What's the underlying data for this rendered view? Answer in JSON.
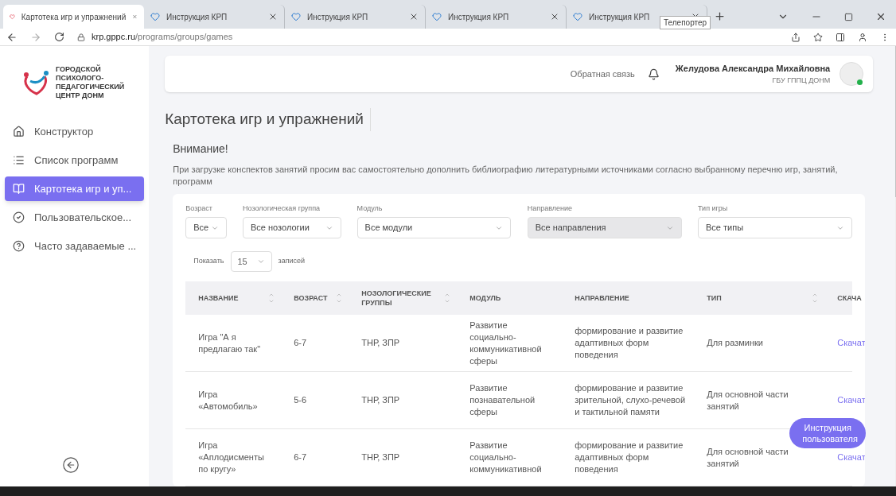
{
  "browser": {
    "tabs": [
      {
        "title": "Картотека игр и упражнений",
        "selected": true
      },
      {
        "title": "Инструкция КРП",
        "selected": false
      },
      {
        "title": "Инструкция КРП",
        "selected": false
      },
      {
        "title": "Инструкция КРП",
        "selected": false
      },
      {
        "title": "Инструкция КРП",
        "selected": false
      }
    ],
    "tooltip": "Телепортер",
    "url_host": "krp.gppc.ru",
    "url_path": "/programs/groups/games"
  },
  "sidebar": {
    "logo_lines": [
      "ГОРОДСКОЙ",
      "ПСИХОЛОГО-",
      "ПЕДАГОГИЧЕСКИЙ",
      "ЦЕНТР ДОНМ"
    ],
    "items": [
      {
        "kind": "home",
        "label": "Конструктор",
        "selected": false
      },
      {
        "kind": "list",
        "label": "Список программ",
        "selected": false
      },
      {
        "kind": "book",
        "label": "Картотека игр и уп...",
        "selected": true
      },
      {
        "kind": "check",
        "label": "Пользовательское...",
        "selected": false
      },
      {
        "kind": "help",
        "label": "Часто задаваемые ...",
        "selected": false
      }
    ]
  },
  "header": {
    "feedback": "Обратная связь",
    "user_name": "Желудова Александра Михайловна",
    "user_org": "ГБУ ГППЦ ДОНМ",
    "online": true
  },
  "page_title": "Картотека игр и упражнений",
  "notice": {
    "title": "Внимание!",
    "text": "При загрузке конспектов занятий просим вас самостоятельно дополнить библиографию литературными источниками согласно выбранному перечню игр, занятий, программ"
  },
  "filters": [
    {
      "label": "Возраст",
      "value": "Все",
      "disabled": false
    },
    {
      "label": "Нозологическая группа",
      "value": "Все нозологии",
      "disabled": false
    },
    {
      "label": "Модуль",
      "value": "Все модули",
      "disabled": false
    },
    {
      "label": "Направление",
      "value": "Все направления",
      "disabled": true
    },
    {
      "label": "Тип игры",
      "value": "Все типы",
      "disabled": false
    }
  ],
  "page_size": {
    "before": "Показать",
    "value": "15",
    "after": "записей"
  },
  "table": {
    "columns": [
      {
        "label": "НАЗВАНИЕ",
        "sortable": true
      },
      {
        "label": "ВОЗРАСТ",
        "sortable": true
      },
      {
        "label": "НОЗОЛОГИЧЕСКИЕ ГРУППЫ",
        "sortable": true
      },
      {
        "label": "МОДУЛЬ",
        "sortable": false
      },
      {
        "label": "НАПРАВЛЕНИЕ",
        "sortable": false
      },
      {
        "label": "ТИП",
        "sortable": true
      },
      {
        "label": "СКАЧА",
        "sortable": false
      }
    ],
    "rows": [
      [
        "Игра \"А я предлагаю так\"",
        "6-7",
        "ТНР, ЗПР",
        "Развитие социально-коммуникативной сферы",
        "формирование и развитие адаптивных форм поведения",
        "Для разминки",
        "Скачат"
      ],
      [
        "Игра «Автомобиль»",
        "5-6",
        "ТНР, ЗПР",
        "Развитие познавательной сферы",
        "формирование и развитие зрительной, слухо-речевой и тактильной памяти",
        "Для основной части занятий",
        "Скачат"
      ],
      [
        "Игра «Аплодисменты по кругу»",
        "6-7",
        "ТНР, ЗПР",
        "Развитие социально-коммуникативной",
        "формирование и развитие адаптивных форм поведения",
        "Для основной части занятий",
        "Скачат"
      ]
    ]
  },
  "help_button": "Инструкция пользователя"
}
